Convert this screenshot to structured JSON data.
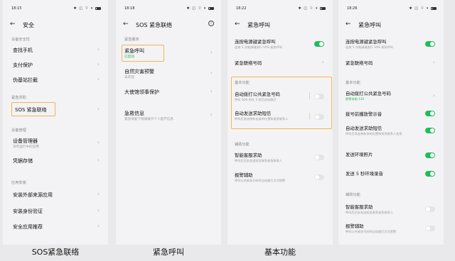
{
  "status": {
    "battery_icon": "battery-icon",
    "icons_text": "✱ ◫ ⌔ ▾"
  },
  "phone1": {
    "time": "18:15",
    "title": "安全",
    "sections": [
      "设备安全性",
      "紧急求助",
      "设备管理",
      "应用安装"
    ],
    "items": [
      {
        "label": "查找手机"
      },
      {
        "label": "支付保护"
      },
      {
        "label": "伪基站拦截"
      },
      {
        "label": "SOS 紧急联络"
      },
      {
        "label": "设备管理器",
        "sub": "没有运行中的应用"
      },
      {
        "label": "凭据存储"
      },
      {
        "label": "安装外部来源应用"
      },
      {
        "label": "安装身份验证"
      },
      {
        "label": "安全应用推荐"
      }
    ],
    "caption": "SOS紧急联络"
  },
  "phone2": {
    "time": "18:18",
    "title": "SOS 紧急联络",
    "sections": [
      "紧急服务"
    ],
    "items": [
      {
        "label": "紧急呼叫",
        "sub": "已启动"
      },
      {
        "label": "自然灾害预警",
        "sub": "未开启"
      },
      {
        "label": "大使馆领事保护"
      },
      {
        "label": "急救信息",
        "sub": "紧急恢复下快速展示个人医疗信息"
      }
    ],
    "caption": "紧急呼叫"
  },
  "phone3": {
    "time": "18:22",
    "title": "紧急呼叫",
    "sections": [
      "基本功能",
      "辅助功能"
    ],
    "items": [
      {
        "label": "连按电源键紧急呼叫",
        "sub": "连按 5 次电源键进行 SOS 紧急呼叫",
        "toggle": true
      },
      {
        "label": "紧急联络号码"
      },
      {
        "label": "自动拨打公共紧急号码",
        "sub": "呼叫 SOS 时在 3 秒后自动拨打",
        "toggle": false
      },
      {
        "label": "自动发送求助短信",
        "sub": "呼叫后发送带有自身的位置和紧急联系人",
        "toggle": false
      },
      {
        "label": "智能客服求助",
        "sub": "呼叫后后台发送短信联系紧急联系人",
        "toggle": false
      },
      {
        "label": "报警辅助",
        "sub": "呼叫公共紧急号码时自动拨打文字报警",
        "toggle": false
      }
    ],
    "caption": "基本功能"
  },
  "phone4": {
    "time": "18:26",
    "title": "紧急呼叫",
    "sections": [
      "基本功能",
      "辅助功能"
    ],
    "items": [
      {
        "label": "连按电源键紧急呼叫",
        "sub": "连按 5 次电源键进行 SOS 紧急呼叫",
        "toggle": true
      },
      {
        "label": "紧急联络号码"
      },
      {
        "label": "自动拨打公共紧急号码",
        "sub": "报警求助 110",
        "toggle": null
      },
      {
        "label": "拨号前播放警示音",
        "toggle": true
      },
      {
        "label": "自动发送求助短信",
        "sub": "呼叫后发送带有你的位置和紧急联系人信息",
        "toggle": true
      },
      {
        "label": "发送环境照片",
        "toggle": true
      },
      {
        "label": "发送 5 秒环境录音",
        "toggle": true
      },
      {
        "label": "智能客服求助",
        "sub": "呼叫后后台发送短信联系紧急联系人",
        "toggle": false
      },
      {
        "label": "报警辅助",
        "sub": "呼叫公共紧急号码时自动拨打文字报警",
        "toggle": false
      }
    ]
  },
  "icons": {
    "back": "back-arrow-icon",
    "chevron": "chevron-right-icon",
    "info": "info-icon"
  },
  "colors": {
    "highlight": "#f1b64a",
    "toggle_on": "#1fbc5c",
    "toggle_off": "#e4e4e6",
    "screen_bg": "#f3f3f5",
    "page_bg": "#e9e9eb"
  }
}
